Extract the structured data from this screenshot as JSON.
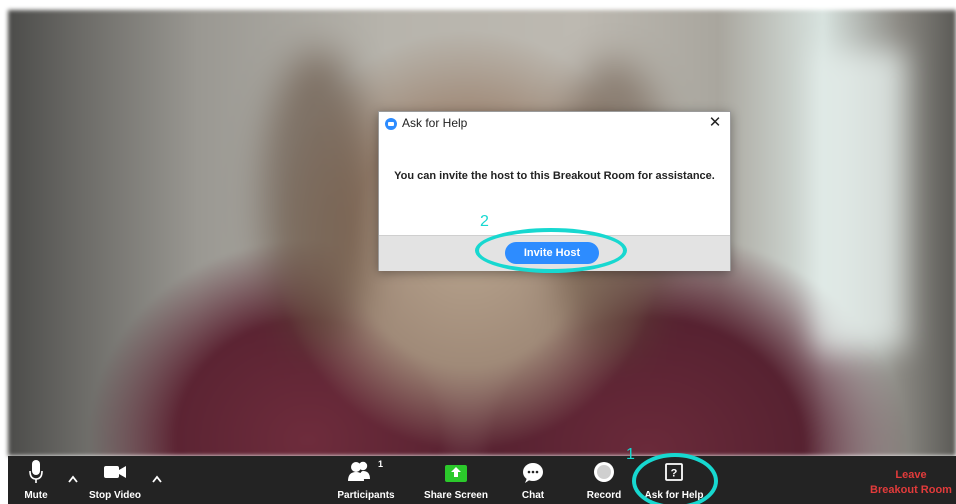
{
  "dialog": {
    "title": "Ask for Help",
    "close_glyph": "✕",
    "message": "You can invite the host to this Breakout Room for assistance.",
    "invite_label": "Invite Host"
  },
  "annotations": {
    "step1": "1",
    "step2": "2",
    "color": "#17d8d0"
  },
  "toolbar": {
    "mute": "Mute",
    "stop_video": "Stop Video",
    "participants": "Participants",
    "participants_count": "1",
    "share_screen": "Share Screen",
    "chat": "Chat",
    "record": "Record",
    "ask_for_help": "Ask for Help",
    "leave_line1": "Leave",
    "leave_line2": "Breakout Room"
  },
  "icons": [
    "microphone-icon",
    "chevron-up-icon",
    "video-camera-icon",
    "participants-icon",
    "share-screen-icon",
    "chat-icon",
    "record-icon",
    "help-icon",
    "zoom-app-icon",
    "close-icon"
  ],
  "colors": {
    "accent": "#2d8cff",
    "toolbar": "#232323",
    "share_green": "#2bc92b",
    "leave_red": "#e23b3b"
  }
}
